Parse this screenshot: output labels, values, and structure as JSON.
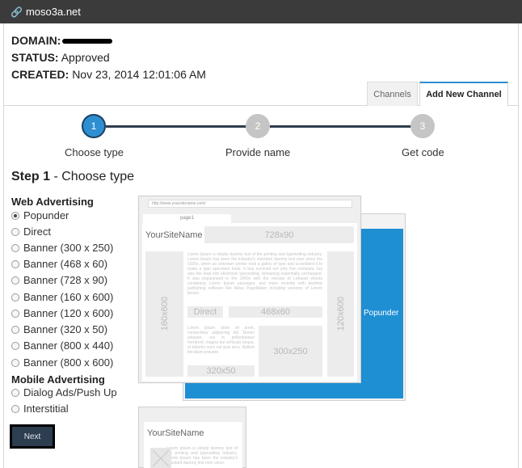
{
  "window": {
    "title": "moso3a.net",
    "icon": "link-icon"
  },
  "meta": {
    "domain_label": "DOMAIN:",
    "status_label": "STATUS:",
    "status_value": "Approved",
    "created_label": "CREATED:",
    "created_value": "Nov 23, 2014 12:01:06 AM"
  },
  "tabs": [
    {
      "label": "Channels",
      "active": false
    },
    {
      "label": "Add New Channel",
      "active": true
    }
  ],
  "steps": [
    {
      "number": "1",
      "label": "Choose type",
      "active": true
    },
    {
      "number": "2",
      "label": "Provide name",
      "active": false
    },
    {
      "number": "3",
      "label": "Get code",
      "active": false
    }
  ],
  "step_heading": {
    "prefix": "Step 1",
    "text": " - Choose type"
  },
  "web_advertising": {
    "title": "Web Advertising",
    "options": [
      "Popunder",
      "Direct",
      "Banner (300 x 250)",
      "Banner (468 x 60)",
      "Banner (728 x 90)",
      "Banner (160 x 600)",
      "Banner (120 x 600)",
      "Banner (320 x 50)",
      "Banner (800 x 440)",
      "Banner (800 x 600)"
    ],
    "selected": "Popunder"
  },
  "mobile_advertising": {
    "title": "Mobile Advertising",
    "options": [
      "Dialog Ads/Push Up",
      "Interstitial"
    ]
  },
  "next_button": "Next",
  "preview": {
    "url": "http://www.yoursitename.com/",
    "page_tab": "page1",
    "site_name": "YourSiteName",
    "banner_728": "728x90",
    "banner_160": "160x600",
    "banner_120": "120x600",
    "direct": "Direct",
    "banner_468": "468x60",
    "banner_300": "300x250",
    "banner_320": "320x50",
    "popunder": "Popunder",
    "lorem_1": "Lorem Ipsum is simply dummy text of the printing and typesetting industry. Lorem Ipsum has been the industry's standard dummy text ever since the 1500s, when an unknown printer took a galley of type and scrambled it to make a type specimen book. It has survived not only five centuries, but also the leap into electronic typesetting, remaining essentially unchanged. It was popularised in the 1960s with the release of Letraset sheets containing Lorem Ipsum passages, and more recently with desktop publishing software like Aldus PageMaker including versions of Lorem Ipsum.",
    "lorem_2": "Lorem Ipsum dolor sit amet, consectetur adipiscing elit. Donec aliquam, est in pellentesque hendrerit, magna dui vehicula neque, et lobortis nunc est quis arcu. Nullam tincidunt posuere.",
    "mobile_site_name": "YourSiteName",
    "lorem_3": "Lorem Ipsum is simply dummy text of the printing and typesetting industry. Lorem Ipsum has been the industry's standard dummy text ever since."
  }
}
